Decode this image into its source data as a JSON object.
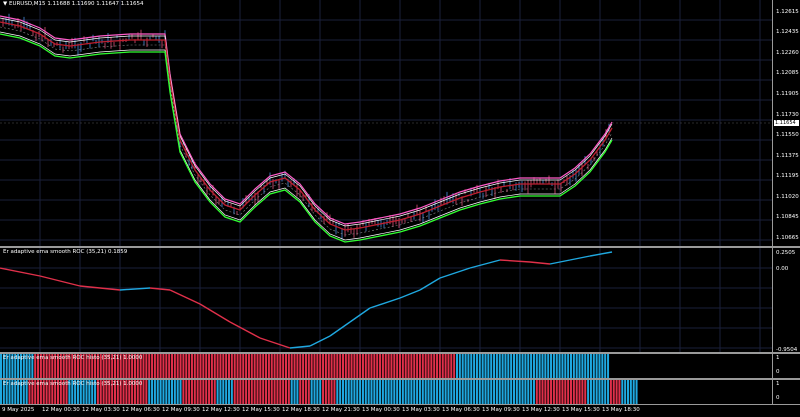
{
  "main": {
    "symbol_label": "EURUSD,M15",
    "ohlc_label": "1.11688 1.11690 1.11647 1.11654",
    "current_price_label": "1.11654",
    "price_ticks": [
      "1.12615",
      "1.12435",
      "1.12260",
      "1.12085",
      "1.11905",
      "1.11730",
      "1.11550",
      "1.11375",
      "1.11195",
      "1.11020",
      "1.10845",
      "1.10665"
    ]
  },
  "indicators": [
    {
      "title": "Er adaptive ema smooth ROC (35,21) 0.1859",
      "ticks": [
        "0.2505",
        "0.00",
        "-0.9504"
      ]
    },
    {
      "title": "Er adaptive ema smooth ROC histo (35,21) 1.0000",
      "ticks": [
        "1",
        "0"
      ]
    },
    {
      "title": "Er adaptive ema smooth ROC histo (35,21) 1.0000",
      "ticks": [
        "1",
        "0"
      ]
    }
  ],
  "time_labels": [
    "9 May 2025",
    "12 May 00:30",
    "12 May 03:30",
    "12 May 06:30",
    "12 May 09:30",
    "12 May 12:30",
    "12 May 15:30",
    "12 May 18:30",
    "12 May 21:30",
    "13 May 00:30",
    "13 May 03:30",
    "13 May 06:30",
    "13 May 09:30",
    "13 May 12:30",
    "13 May 15:30",
    "13 May 18:30"
  ],
  "colors": {
    "up": "#1fa8e0",
    "down": "#e0304a",
    "envelope_outer": "#ff5cc8",
    "envelope_inner": "#30ff30",
    "grid": "#1a1f3a"
  },
  "histo1_segments": [
    {
      "color": "up",
      "count": 12
    },
    {
      "color": "down",
      "count": 148
    },
    {
      "color": "up",
      "count": 54
    }
  ],
  "histo2_segments": [
    {
      "color": "up",
      "count": 10
    },
    {
      "color": "down",
      "count": 14
    },
    {
      "color": "up",
      "count": 10
    },
    {
      "color": "down",
      "count": 18
    },
    {
      "color": "up",
      "count": 12
    },
    {
      "color": "down",
      "count": 12
    },
    {
      "color": "up",
      "count": 6
    },
    {
      "color": "down",
      "count": 20
    },
    {
      "color": "up",
      "count": 3
    },
    {
      "color": "down",
      "count": 4
    },
    {
      "color": "up",
      "count": 4
    },
    {
      "color": "down",
      "count": 5
    },
    {
      "color": "up",
      "count": 70
    },
    {
      "color": "down",
      "count": 18
    },
    {
      "color": "up",
      "count": 8
    },
    {
      "color": "down",
      "count": 4
    },
    {
      "color": "up",
      "count": 6
    }
  ]
}
